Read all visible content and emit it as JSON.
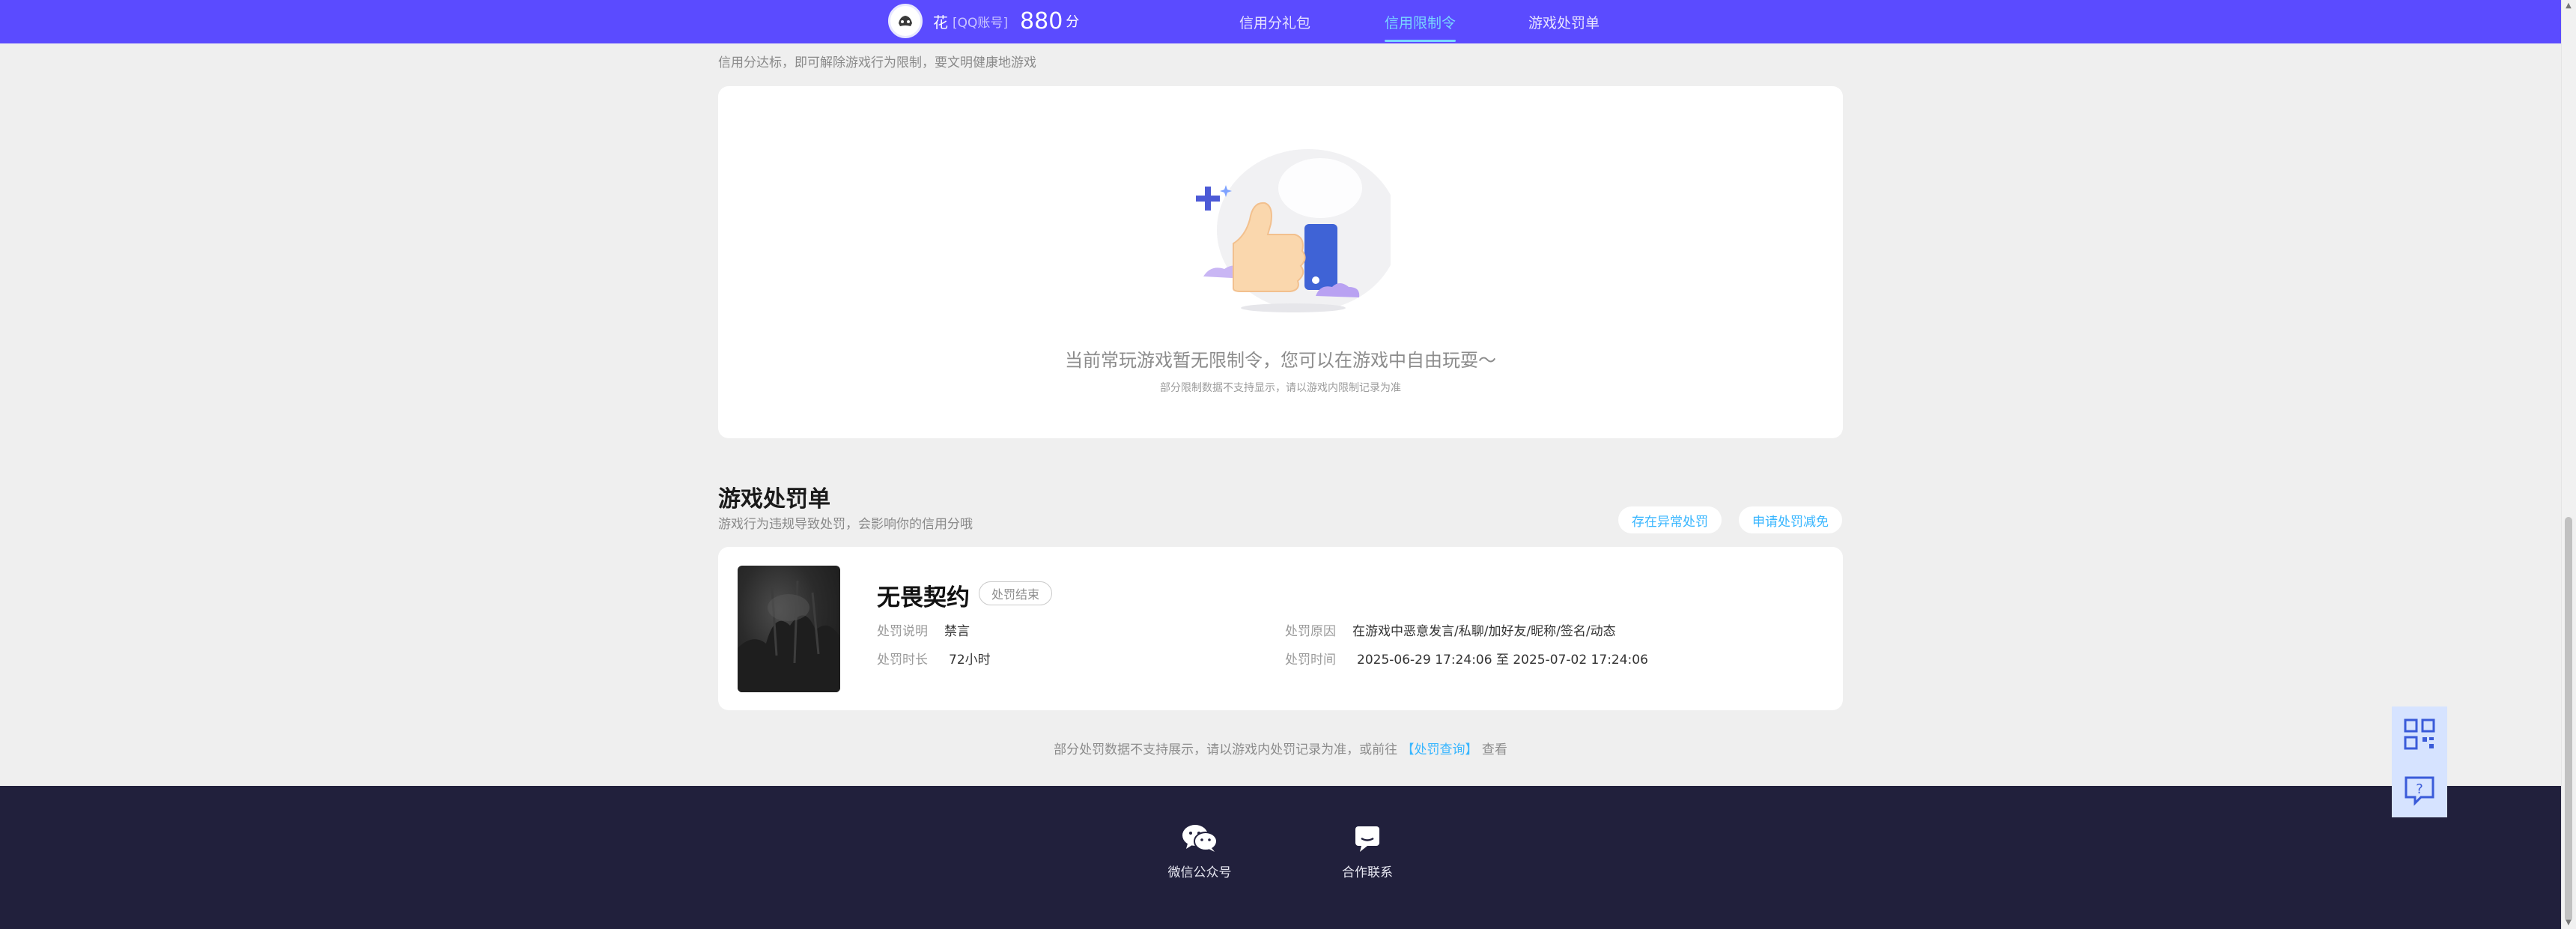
{
  "header": {
    "user_name": "花",
    "account_type": "[QQ账号]",
    "credit_score": "880",
    "score_unit": "分",
    "nav": [
      {
        "label": "信用分礼包"
      },
      {
        "label": "信用限制令"
      },
      {
        "label": "游戏处罚单"
      }
    ],
    "active_tab": "信用限制令"
  },
  "restriction": {
    "subtitle": "信用分达标，即可解除游戏行为限制，要文明健康地游戏",
    "empty_message": "当前常玩游戏暂无限制令，您可以在游戏中自由玩耍～",
    "empty_note": "部分限制数据不支持显示，请以游戏内限制记录为准"
  },
  "penalty": {
    "title": "游戏处罚单",
    "subtitle": "游戏行为违规导致处罚，会影响你的信用分哦",
    "btn_report": "存在异常处罚",
    "btn_appeal": "申请处罚减免",
    "item": {
      "game_name": "无畏契约",
      "status": "处罚结束",
      "desc_label": "处罚说明",
      "desc_value": "禁言",
      "duration_label": "处罚时长",
      "duration_value": "72小时",
      "reason_label": "处罚原因",
      "reason_value": "在游戏中恶意发言/私聊/加好友/昵称/签名/动态",
      "time_label": "处罚时间",
      "time_value": "2025-06-29 17:24:06 至 2025-07-02 17:24:06"
    },
    "note_before": "部分处罚数据不支持展示，请以游戏内处罚记录为准，或前往",
    "note_link": "【处罚查询】",
    "note_after": "查看"
  },
  "footer": {
    "wechat_label": "微信公众号",
    "contact_label": "合作联系"
  },
  "floating": {
    "qr_icon": "qr-code-icon",
    "help_icon": "help-icon"
  },
  "colors": {
    "nav_bg": "#5b4bff",
    "accent": "#38b6ff",
    "footer_bg": "#21203c",
    "page_bg": "#efefef"
  }
}
